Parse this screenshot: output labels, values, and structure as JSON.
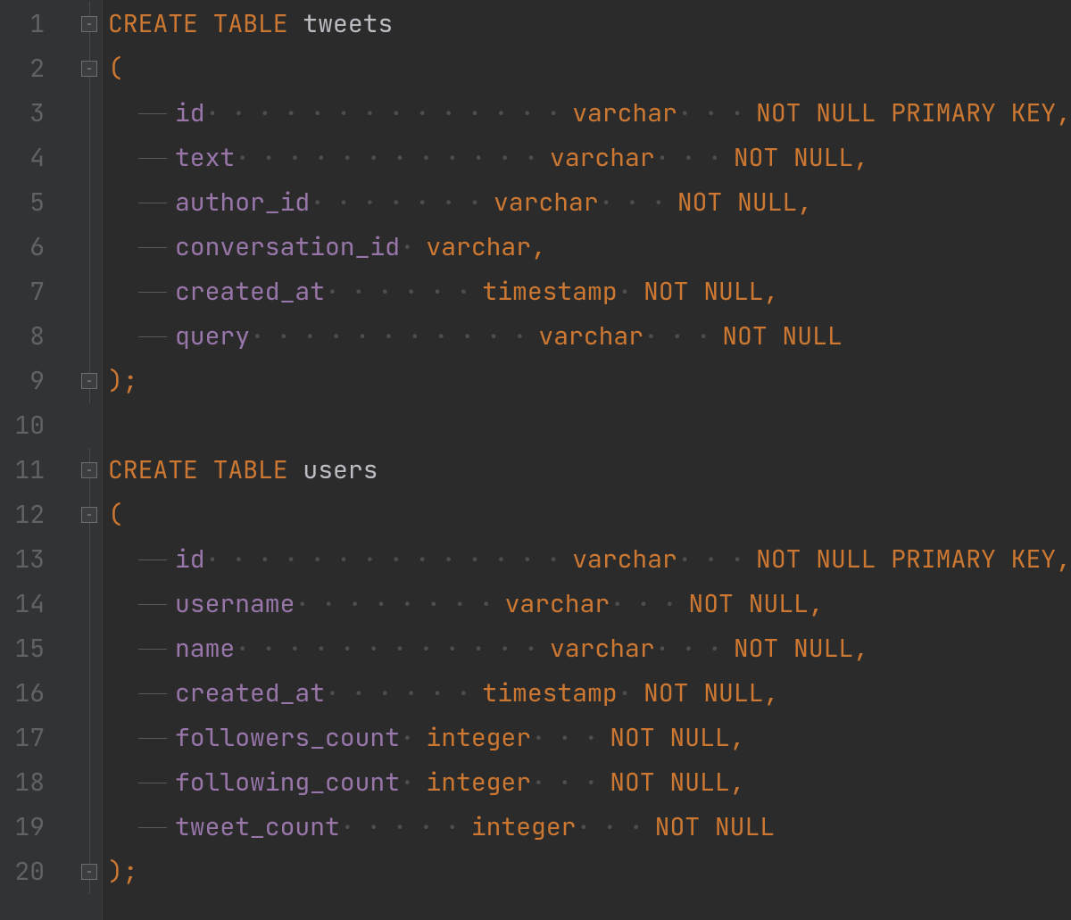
{
  "keywords": {
    "create_table": "CREATE TABLE",
    "not_null": "NOT NULL",
    "primary_key": "PRIMARY KEY"
  },
  "tables": [
    {
      "name": "tweets",
      "open_line": 1,
      "paren_open_line": 2,
      "paren_close_line": 9,
      "columns": [
        {
          "line": 3,
          "name": "id",
          "type": "varchar",
          "not_null": true,
          "primary_key": true
        },
        {
          "line": 4,
          "name": "text",
          "type": "varchar",
          "not_null": true,
          "primary_key": false
        },
        {
          "line": 5,
          "name": "author_id",
          "type": "varchar",
          "not_null": true,
          "primary_key": false
        },
        {
          "line": 6,
          "name": "conversation_id",
          "type": "varchar",
          "not_null": false,
          "primary_key": false
        },
        {
          "line": 7,
          "name": "created_at",
          "type": "timestamp",
          "not_null": true,
          "primary_key": false
        },
        {
          "line": 8,
          "name": "query",
          "type": "varchar",
          "not_null": true,
          "primary_key": false
        }
      ]
    },
    {
      "name": "users",
      "open_line": 11,
      "paren_open_line": 12,
      "paren_close_line": 20,
      "columns": [
        {
          "line": 13,
          "name": "id",
          "type": "varchar",
          "not_null": true,
          "primary_key": true
        },
        {
          "line": 14,
          "name": "username",
          "type": "varchar",
          "not_null": true,
          "primary_key": false
        },
        {
          "line": 15,
          "name": "name",
          "type": "varchar",
          "not_null": true,
          "primary_key": false
        },
        {
          "line": 16,
          "name": "created_at",
          "type": "timestamp",
          "not_null": true,
          "primary_key": false
        },
        {
          "line": 17,
          "name": "followers_count",
          "type": "integer",
          "not_null": true,
          "primary_key": false
        },
        {
          "line": 18,
          "name": "following_count",
          "type": "integer",
          "not_null": true,
          "primary_key": false
        },
        {
          "line": 19,
          "name": "tweet_count",
          "type": "integer",
          "not_null": true,
          "primary_key": false
        }
      ]
    }
  ],
  "total_lines": 20
}
